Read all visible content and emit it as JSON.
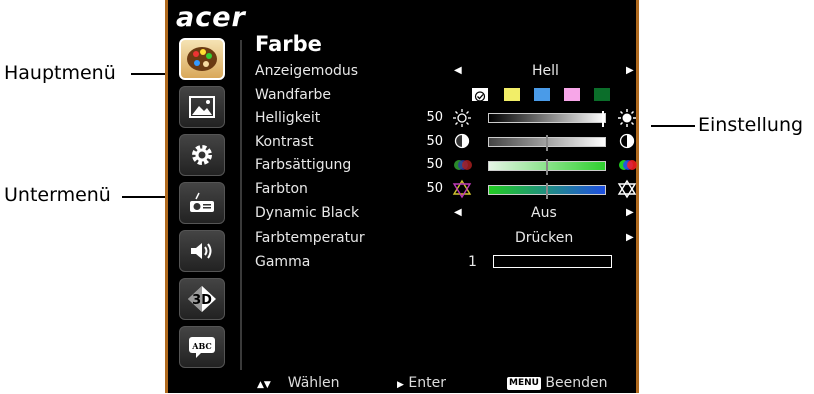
{
  "callouts": {
    "main_menu": "Hauptmenü",
    "sub_menu": "Untermenü",
    "setting": "Einstellung"
  },
  "osd": {
    "brand": "acer",
    "title": "Farbe",
    "menu_icons": [
      "palette-icon",
      "image-icon",
      "gear-icon",
      "projector-icon",
      "speaker-icon",
      "3d-icon",
      "abc-language-icon"
    ],
    "rows": {
      "display_mode": {
        "label": "Anzeigemodus",
        "value": "Hell"
      },
      "wall_color": {
        "label": "Wandfarbe",
        "swatches": [
          "#f2ee68",
          "#4a9be8",
          "#f7a6e8",
          "#0b6e2a"
        ]
      },
      "brightness": {
        "label": "Helligkeit",
        "value": "50",
        "level": 0.98
      },
      "contrast": {
        "label": "Kontrast",
        "value": "50",
        "level": 0.5
      },
      "saturation": {
        "label": "Farbsättigung",
        "value": "50",
        "level": 0.5
      },
      "hue": {
        "label": "Farbton",
        "value": "50",
        "level": 0.5
      },
      "dynamic_black": {
        "label": "Dynamic Black",
        "value": "Aus"
      },
      "color_temp": {
        "label": "Farbtemperatur",
        "value": "Drücken"
      },
      "gamma": {
        "label": "Gamma",
        "value": "1"
      }
    },
    "footer": {
      "select": "Wählen",
      "enter": "Enter",
      "menu_key": "MENU",
      "exit": "Beenden"
    }
  }
}
